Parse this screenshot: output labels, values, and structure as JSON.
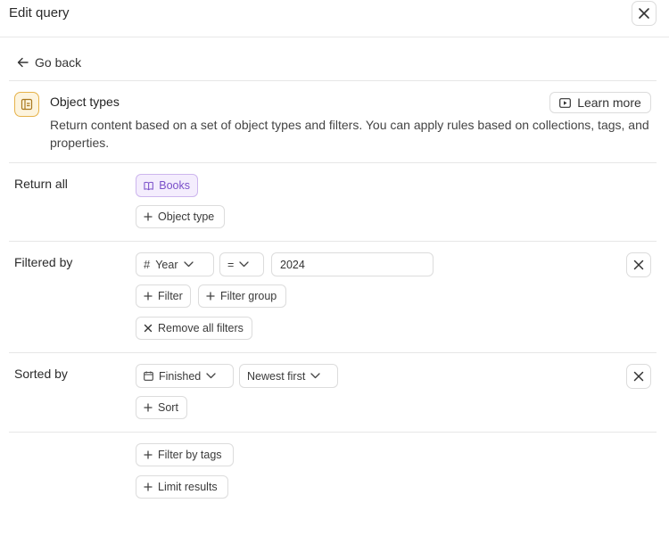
{
  "header": {
    "title": "Edit query"
  },
  "nav": {
    "back_label": "Go back"
  },
  "object_types": {
    "title": "Object types",
    "description": "Return content based on a set of object types and filters. You can apply rules based on collections, tags, and properties.",
    "learn_more_label": "Learn more"
  },
  "return_all": {
    "label": "Return all",
    "selected_type": "Books",
    "add_type_label": "Object type"
  },
  "filtered_by": {
    "label": "Filtered by",
    "field": "Year",
    "operator": "=",
    "value": "2024",
    "add_filter_label": "Filter",
    "add_group_label": "Filter group",
    "remove_all_label": "Remove all filters"
  },
  "sorted_by": {
    "label": "Sorted by",
    "field": "Finished",
    "order": "Newest first",
    "add_sort_label": "Sort"
  },
  "extras": {
    "filter_tags_label": "Filter by tags",
    "limit_label": "Limit results"
  }
}
